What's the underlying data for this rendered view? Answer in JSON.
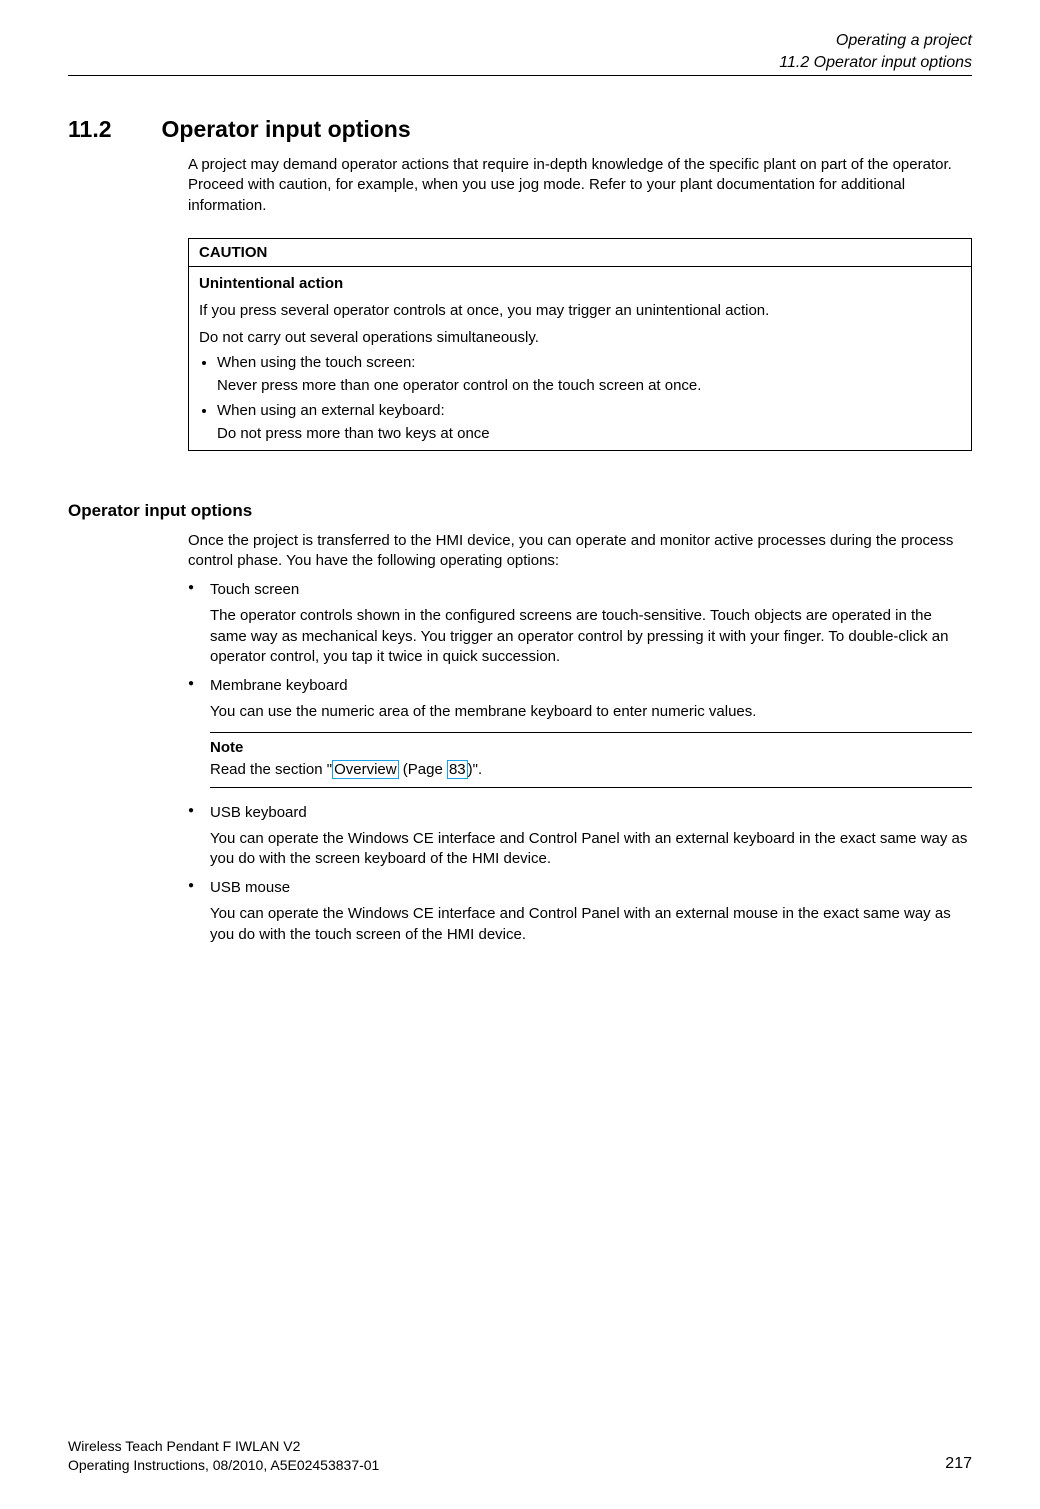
{
  "header": {
    "chapter": "Operating a project",
    "section": "11.2 Operator input options"
  },
  "section": {
    "number": "11.2",
    "title": "Operator input options",
    "intro": "A project may demand operator actions that require in-depth knowledge of the specific plant on part of the operator. Proceed with caution, for example, when you use jog mode. Refer to your plant documentation for additional information."
  },
  "caution": {
    "label": "CAUTION",
    "subtitle": "Unintentional action",
    "line1": "If you press several operator controls at once, you may trigger an unintentional action.",
    "line2": "Do not carry out several operations simultaneously.",
    "items": [
      {
        "label": "When using the touch screen:",
        "detail": "Never press more than one operator control on the touch screen at once."
      },
      {
        "label": "When using an external keyboard:",
        "detail": "Do not press more than two keys at once"
      }
    ]
  },
  "subsection": {
    "heading": "Operator input options",
    "intro": "Once the project is transferred to the HMI device, you can operate and monitor active processes during the process control phase. You have the following operating options:",
    "options": [
      {
        "title": "Touch screen",
        "desc": "The operator controls shown in the configured screens are touch-sensitive. Touch objects are operated in the same way as mechanical keys. You trigger an operator control by pressing it with your finger. To double-click an operator control, you tap it twice in quick succession."
      },
      {
        "title": "Membrane keyboard",
        "desc": "You can use the numeric area of the membrane keyboard to enter numeric values."
      },
      {
        "title": "USB keyboard",
        "desc": "You can operate the Windows CE interface and Control Panel with an external keyboard in the exact same way as you do with the screen keyboard of the HMI device."
      },
      {
        "title": "USB mouse",
        "desc": "You can operate the Windows CE interface and Control Panel with an external mouse in the exact same way as you do with the touch screen of the HMI device."
      }
    ]
  },
  "note": {
    "label": "Note",
    "prefix": "Read the section \"",
    "link1": "Overview",
    "mid": " (Page ",
    "link2": "83",
    "suffix": ")\"."
  },
  "footer": {
    "product": "Wireless Teach Pendant F IWLAN V2",
    "docinfo": "Operating Instructions, 08/2010, A5E02453837-01",
    "page": "217"
  }
}
